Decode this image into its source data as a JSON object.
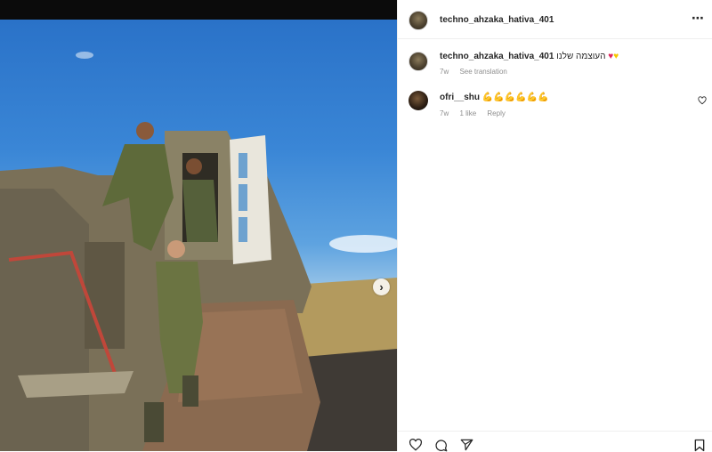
{
  "post": {
    "username": "techno_ahzaka_hativa_401"
  },
  "caption": {
    "username": "techno_ahzaka_hativa_401",
    "text": "העוצמה שלנו",
    "emoji_1": "♥",
    "emoji_2": "♥",
    "time": "7w",
    "see_translation": "See translation"
  },
  "comment": {
    "username": "ofri__shu",
    "text": "💪💪💪💪💪💪",
    "time": "7w",
    "likes": "1 like",
    "reply": "Reply"
  },
  "icons": {
    "more": "more-options-icon",
    "next": "chevron-right-icon",
    "like": "heart-icon",
    "comment": "comment-icon",
    "share": "send-icon",
    "save": "bookmark-icon"
  },
  "colors": {
    "accent_red": "#e0245e",
    "accent_yellow": "#f7c600",
    "muted": "#8e8e8e"
  }
}
